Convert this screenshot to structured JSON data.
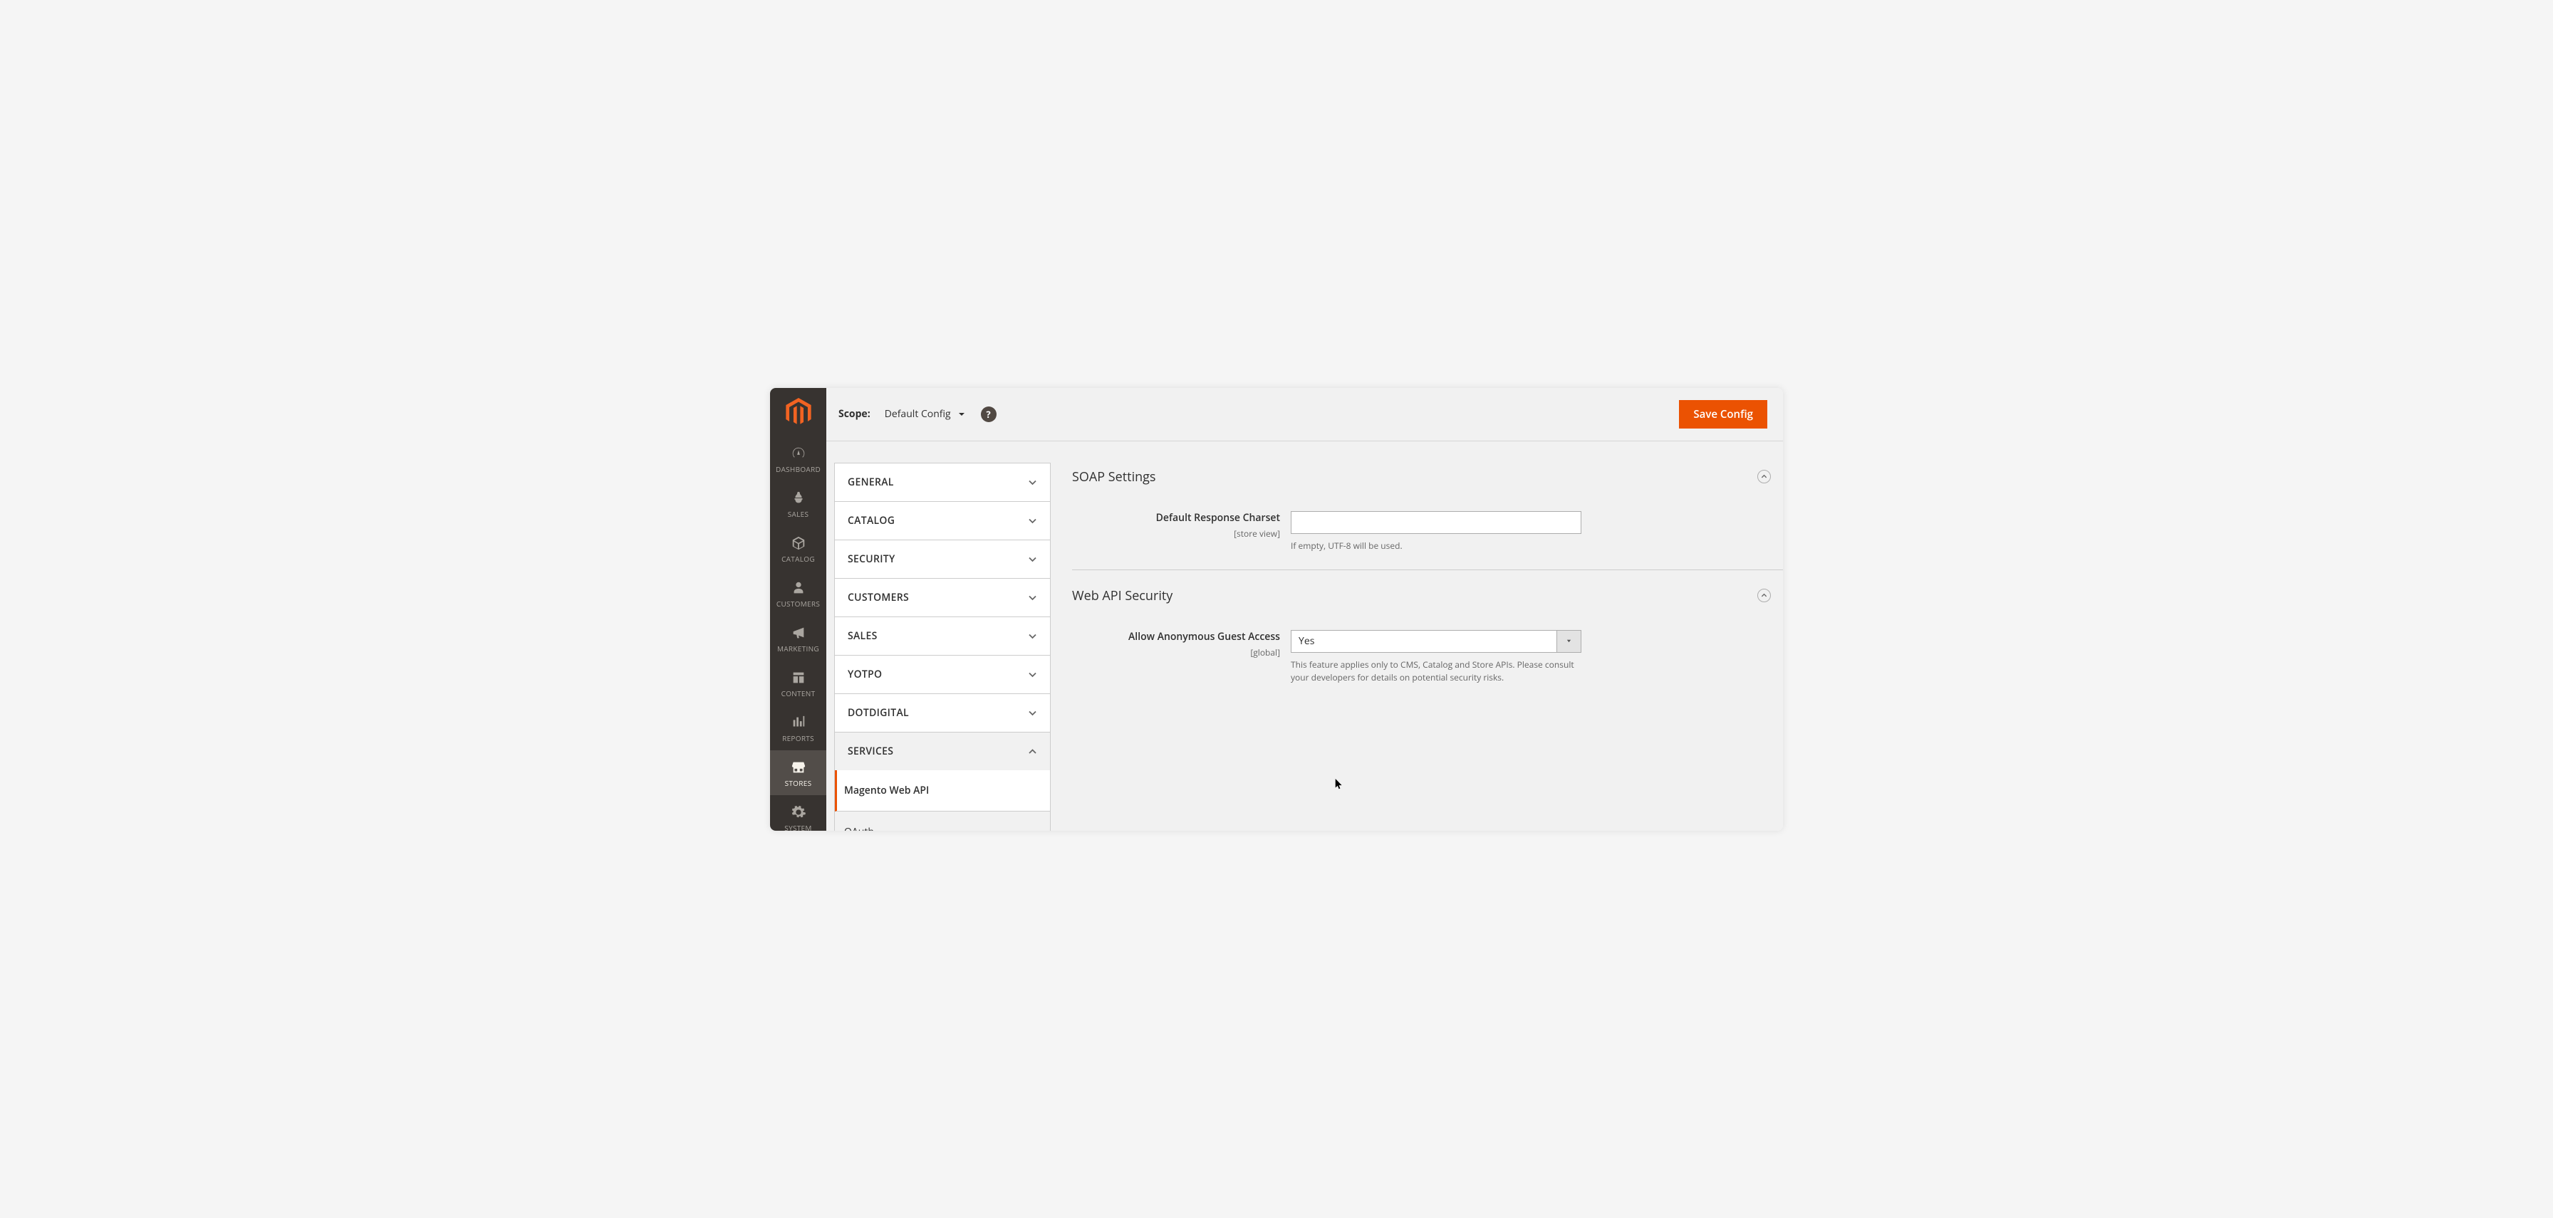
{
  "topbar": {
    "scope_label": "Scope:",
    "scope_value": "Default Config",
    "save_button": "Save Config"
  },
  "sidebar": {
    "items": [
      {
        "label": "DASHBOARD"
      },
      {
        "label": "SALES"
      },
      {
        "label": "CATALOG"
      },
      {
        "label": "CUSTOMERS"
      },
      {
        "label": "MARKETING"
      },
      {
        "label": "CONTENT"
      },
      {
        "label": "REPORTS"
      },
      {
        "label": "STORES"
      },
      {
        "label": "SYSTEM"
      }
    ]
  },
  "accordion": [
    {
      "label": "GENERAL"
    },
    {
      "label": "CATALOG"
    },
    {
      "label": "SECURITY"
    },
    {
      "label": "CUSTOMERS"
    },
    {
      "label": "SALES"
    },
    {
      "label": "YOTPO"
    },
    {
      "label": "DOTDIGITAL"
    },
    {
      "label": "SERVICES"
    }
  ],
  "sub_items": [
    {
      "label": "Magento Web API"
    },
    {
      "label": "OAuth"
    }
  ],
  "sections": {
    "soap": {
      "title": "SOAP Settings",
      "field_label": "Default Response Charset",
      "field_scope": "[store view]",
      "field_value": "",
      "hint": "If empty, UTF-8 will be used."
    },
    "security": {
      "title": "Web API Security",
      "field_label": "Allow Anonymous Guest Access",
      "field_scope": "[global]",
      "field_value": "Yes",
      "hint": "This feature applies only to CMS, Catalog and Store APIs. Please consult your developers for details on potential security risks."
    }
  }
}
